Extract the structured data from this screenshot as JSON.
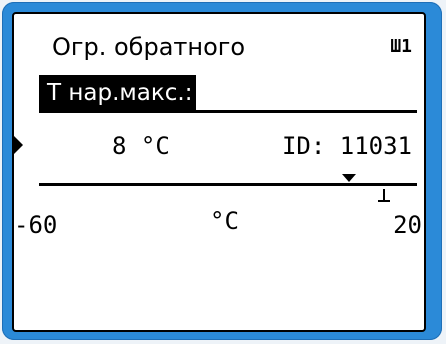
{
  "screen": {
    "title": "Огр. обратного",
    "circuit_indicator": "Ш1",
    "parameter_label": "Т нар.макс.:",
    "current_value": "8 °C",
    "id_text": "ID: 11031",
    "scale": {
      "min_label": "-60",
      "unit_label": "°C",
      "max_label": "20",
      "min_value": -60,
      "max_value": 20,
      "current_value": 8
    }
  },
  "colors": {
    "bezel": "#2b8ad8",
    "lcd_background": "#ffffff",
    "lcd_foreground": "#000000"
  }
}
